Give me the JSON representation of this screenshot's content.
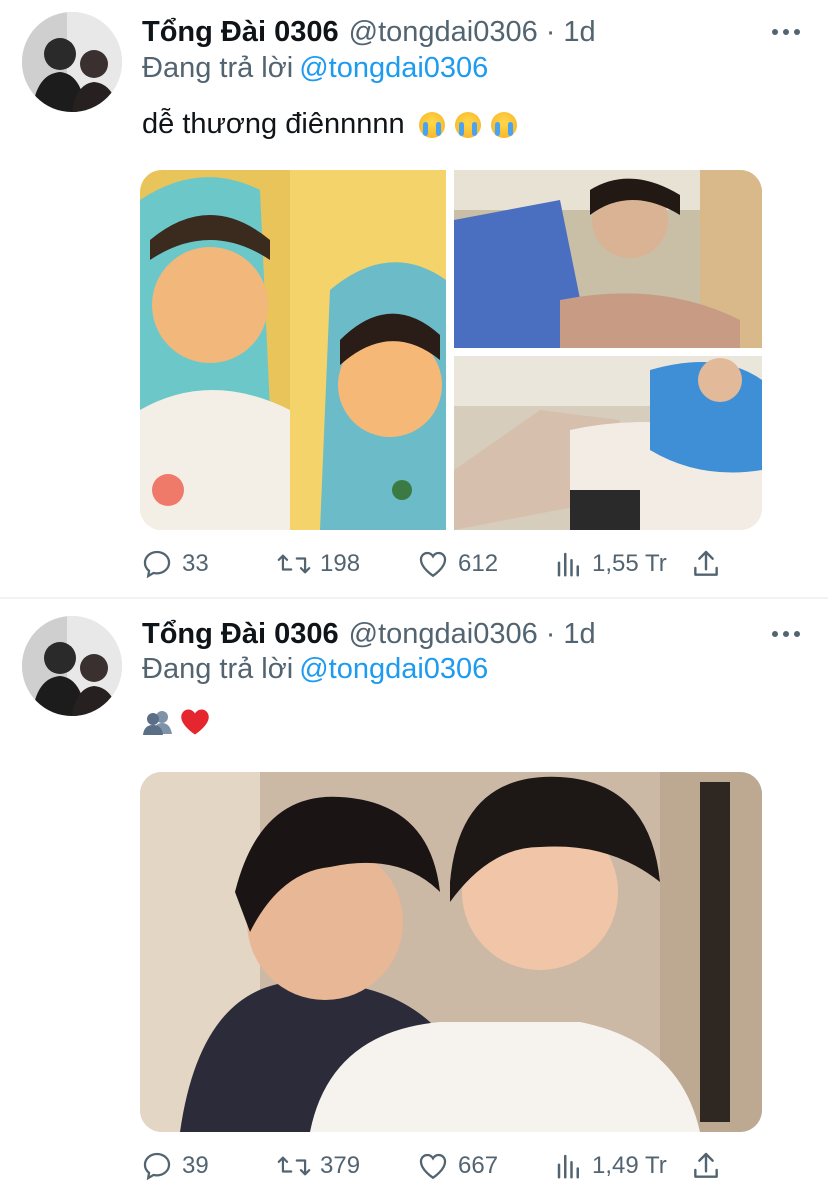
{
  "tweets": [
    {
      "author_name": "Tổng Đài 0306",
      "handle": "@tongdai0306",
      "separator": "·",
      "time": "1d",
      "replying_prefix": "Đang trả lời",
      "replying_to": "@tongdai0306",
      "text": "dễ thương điênnnnn",
      "emoji": [
        "loudly-crying-face",
        "loudly-crying-face",
        "loudly-crying-face"
      ],
      "media_layout": "three-images",
      "stats": {
        "replies": "33",
        "retweets": "198",
        "likes": "612",
        "views": "1,55 Tr"
      }
    },
    {
      "author_name": "Tổng Đài 0306",
      "handle": "@tongdai0306",
      "separator": "·",
      "time": "1d",
      "replying_prefix": "Đang trả lời",
      "replying_to": "@tongdai0306",
      "text": "",
      "emoji": [
        "busts-in-silhouette",
        "red-heart"
      ],
      "media_layout": "single-image",
      "stats": {
        "replies": "39",
        "retweets": "379",
        "likes": "667",
        "views": "1,49 Tr"
      }
    }
  ],
  "icons": [
    "more-icon",
    "reply-icon",
    "retweet-icon",
    "like-icon",
    "views-icon",
    "share-icon"
  ],
  "colors": {
    "link": "#1d9bf0",
    "secondary_text": "#536471",
    "primary_text": "#0f1419",
    "divider": "#eff3f4"
  }
}
